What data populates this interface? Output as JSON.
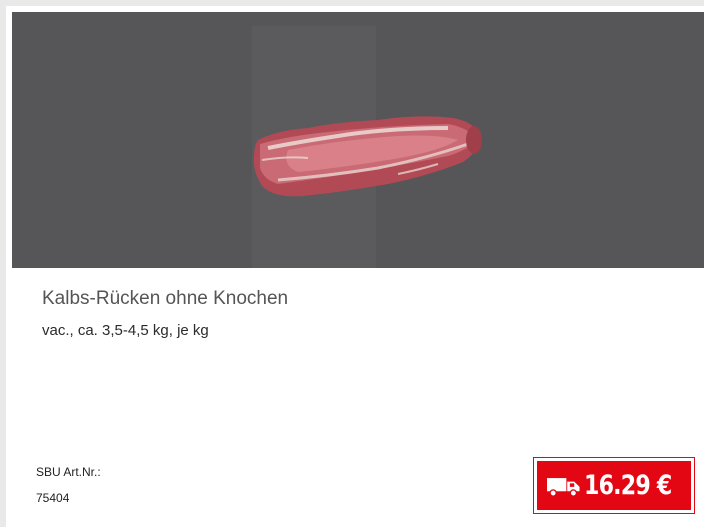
{
  "product": {
    "title": "Kalbs-Rücken ohne Knochen",
    "subtitle": "vac., ca. 3,5-4,5 kg, je kg",
    "article_label": "SBU Art.Nr.:",
    "article_number": "75404",
    "price": "16.29 €",
    "image_icon": "product-photo",
    "delivery_icon": "truck-icon"
  },
  "colors": {
    "image_background": "#565658",
    "price_badge": "#e30613",
    "card_border": "#e9e9e9"
  }
}
